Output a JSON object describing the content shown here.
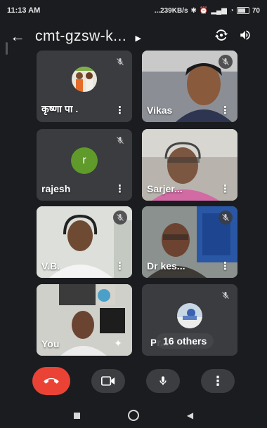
{
  "status_bar": {
    "time": "11:13 AM",
    "network_info": "...239KB/s",
    "battery": "70"
  },
  "meeting": {
    "title": "cmt-gzsw-k..."
  },
  "participants": [
    {
      "name": "कृष्णा पा ."
    },
    {
      "name": "Vikas"
    },
    {
      "name": "rajesh",
      "initial": "r"
    },
    {
      "name": "Sarjer..."
    },
    {
      "name": "V.B."
    },
    {
      "name": "Dr kes..."
    },
    {
      "name": "You"
    },
    {
      "name": "Pr...",
      "others_label": "16 others"
    }
  ],
  "colors": {
    "end_call": "#ea4335",
    "control_bg": "#3c3d41",
    "avatar_green": "#5f9a2b"
  }
}
